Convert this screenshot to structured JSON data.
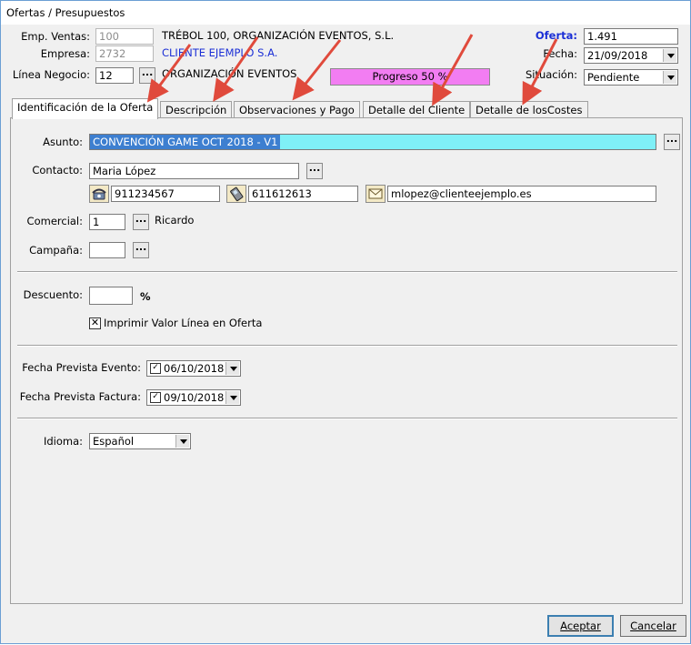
{
  "window": {
    "title": "Ofertas / Presupuestos"
  },
  "header": {
    "emp_ventas_label": "Emp. Ventas:",
    "emp_ventas_value": "100",
    "emp_ventas_name": "TRÉBOL 100, ORGANIZACIÓN EVENTOS, S.L.",
    "empresa_label": "Empresa:",
    "empresa_value": "2732",
    "empresa_name": "CLIENTE EJEMPLO S.A.",
    "linea_label": "Línea Negocio:",
    "linea_value": "12",
    "linea_name": "ORGANIZACIÓN EVENTOS",
    "progress_text": "Progreso  50 %",
    "progress_value": 0.5,
    "oferta_label": "Oferta:",
    "oferta_value": "1.491",
    "fecha_label": "Fecha:",
    "fecha_value": "21/09/2018",
    "situacion_label": "Situación:",
    "situacion_value": "Pendiente",
    "dots_label": "..."
  },
  "tabs": [
    {
      "label": "Identificación de la Oferta"
    },
    {
      "label": "Descripción"
    },
    {
      "label": "Observaciones y Pago"
    },
    {
      "label": "Detalle del Cliente"
    },
    {
      "label": "Detalle de losCostes"
    }
  ],
  "form": {
    "asunto_label": "Asunto:",
    "asunto_value": "CONVENCIÓN GAME OCT 2018 - V1",
    "contacto_label": "Contacto:",
    "contacto_value": "Maria López",
    "phone_value": "911234567",
    "mobile_value": "611612613",
    "email_value": "mlopez@clienteejemplo.es",
    "comercial_label": "Comercial:",
    "comercial_value": "1",
    "comercial_name": "Ricardo",
    "campana_label": "Campaña:",
    "campana_value": "",
    "descuento_label": "Descuento:",
    "descuento_value": "",
    "percent_sign": "%",
    "imprimir_label": "Imprimir Valor Línea en Oferta",
    "imprimir_checked": true,
    "fecha_evento_label": "Fecha Prevista Evento:",
    "fecha_evento_value": "06/10/2018",
    "fecha_factura_label": "Fecha Prevista Factura:",
    "fecha_factura_value": "09/10/2018",
    "idioma_label": "Idioma:",
    "idioma_value": "Español"
  },
  "footer": {
    "accept_label": "Aceptar",
    "cancel_label": "Cancelar"
  },
  "colors": {
    "asunto_highlight": "#7ff0f7",
    "asunto_selection": "#3d7fd0",
    "progress_fill": "#f27df2",
    "link_blue": "#1b2fd6",
    "arrow_red": "#e04a3c"
  },
  "icons": [
    "phone-icon",
    "mobile-icon",
    "email-icon",
    "checkbox-icon",
    "chevron-down-icon"
  ]
}
